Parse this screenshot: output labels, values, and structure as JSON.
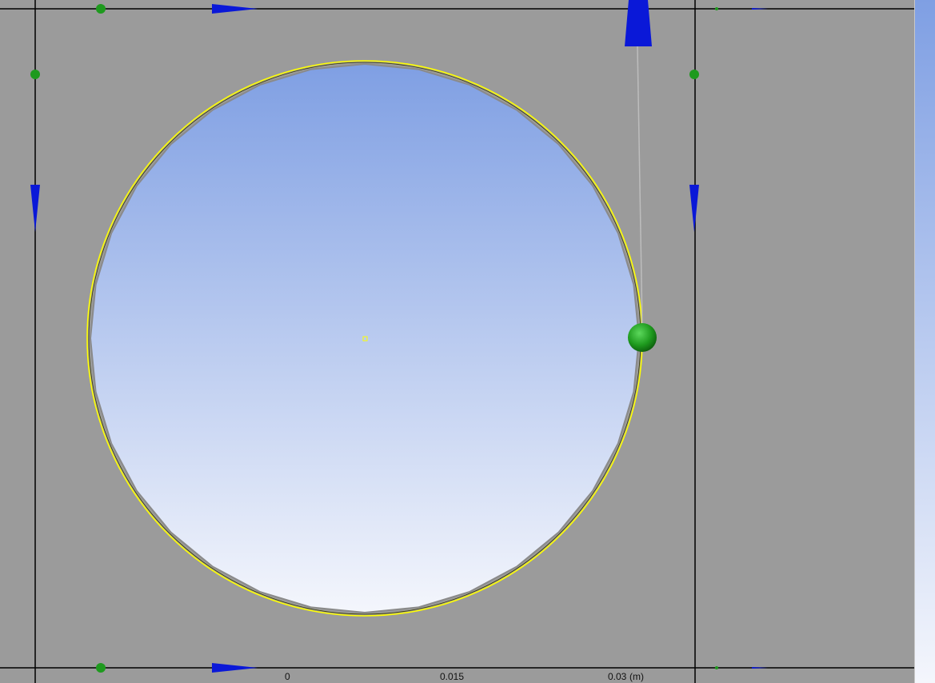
{
  "viewport": {
    "name": "sketch-viewport",
    "background_color": "#9b9b9b",
    "face_gradient": [
      "#7f9fe3",
      "#f4f6fc"
    ],
    "edge_color": "#000000",
    "selection_color": "#ffff00",
    "point_color": "#1e9a1e",
    "arrow_color": "#0a18d8"
  },
  "scale_bar": {
    "ticks": [
      "0",
      "0.015",
      "0.03"
    ],
    "unit": "(m)"
  },
  "icons": [
    "circle-sketch-icon",
    "point-icon",
    "direction-arrow-icon",
    "center-point-icon"
  ]
}
